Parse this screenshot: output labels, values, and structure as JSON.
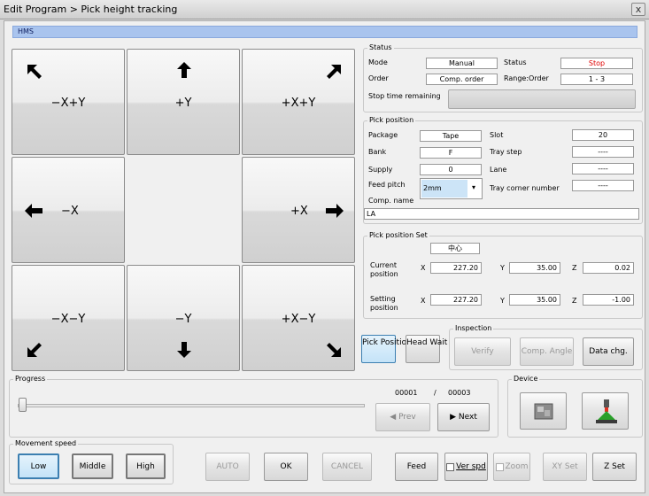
{
  "window": {
    "title": "Edit Program > Pick height tracking",
    "close": "x"
  },
  "hms": {
    "label": "HMS"
  },
  "jog": {
    "up_left": {
      "label": "−X+Y",
      "icon": "arrow-up-left"
    },
    "up": {
      "label": "+Y",
      "icon": "arrow-up"
    },
    "up_right": {
      "label": "+X+Y",
      "icon": "arrow-up-right"
    },
    "left": {
      "label": "−X",
      "icon": "arrow-left"
    },
    "right": {
      "label": "+X",
      "icon": "arrow-right"
    },
    "down_left": {
      "label": "−X−Y",
      "icon": "arrow-down-left"
    },
    "down": {
      "label": "−Y",
      "icon": "arrow-down"
    },
    "down_right": {
      "label": "+X−Y",
      "icon": "arrow-down-right"
    }
  },
  "status": {
    "title": "Status",
    "mode_label": "Mode",
    "mode_value": "Manual",
    "status_label": "Status",
    "status_value": "Stop",
    "status_color": "#e00000",
    "order_label": "Order",
    "order_value": "Comp. order",
    "range_label": "Range:Order",
    "range_value": "1 - 3",
    "stop_time_label": "Stop time remaining"
  },
  "pick": {
    "title": "Pick position",
    "package_label": "Package",
    "package_value": "Tape",
    "slot_label": "Slot",
    "slot_value": "20",
    "bank_label": "Bank",
    "bank_value": "F",
    "tray_step_label": "Tray step",
    "tray_step_value": "----",
    "supply_label": "Supply",
    "supply_value": "0",
    "lane_label": "Lane",
    "lane_value": "----",
    "feed_pitch_label": "Feed pitch",
    "feed_pitch_value": "2mm",
    "tray_corner_label": "Tray corner number",
    "tray_corner_value": "----",
    "comp_name_label": "Comp. name",
    "comp_name_value": "LA"
  },
  "pickset": {
    "title": "Pick position Set",
    "center_value": "中心",
    "current_label": "Current position",
    "current_x": "227.20",
    "current_y": "35.00",
    "current_z": "0.02",
    "setting_label": "Setting position",
    "setting_x": "227.20",
    "setting_y": "35.00",
    "setting_z": "-1.00",
    "x": "X",
    "y": "Y",
    "z": "Z"
  },
  "mode_buttons": {
    "pick_position": "Pick Position",
    "head_wait": "Head Wait"
  },
  "inspection": {
    "title": "Inspection",
    "verify": "Verify",
    "comp_angle": "Comp. Angle",
    "data_chg": "Data chg."
  },
  "progress": {
    "title": "Progress",
    "current": "00001",
    "separator": "/",
    "total": "00003",
    "fraction": 0.0,
    "prev": "Prev",
    "next": "Next"
  },
  "device": {
    "title": "Device",
    "icon1": "camera-view-icon",
    "icon2": "nozzle-device-icon"
  },
  "speed": {
    "title": "Movement speed",
    "low": "Low",
    "middle": "Middle",
    "high": "High",
    "selected": "Low"
  },
  "bottom": {
    "auto": "AUTO",
    "ok": "OK",
    "cancel": "CANCEL",
    "feed": "Feed",
    "ver_spd": "Ver spd",
    "zoom": "Zoom",
    "xy_set": "XY Set",
    "z_set": "Z Set"
  }
}
